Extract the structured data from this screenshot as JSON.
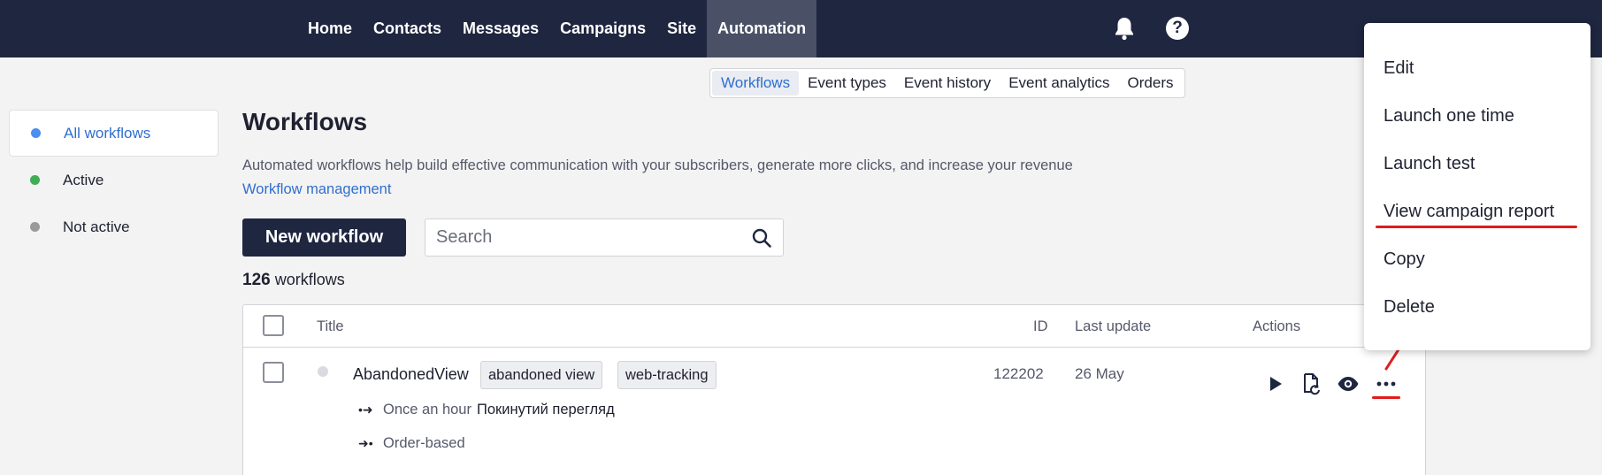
{
  "nav": {
    "items": [
      {
        "label": "Home",
        "active": false
      },
      {
        "label": "Contacts",
        "active": false
      },
      {
        "label": "Messages",
        "active": false
      },
      {
        "label": "Campaigns",
        "active": false
      },
      {
        "label": "Site",
        "active": false
      },
      {
        "label": "Automation",
        "active": true
      }
    ],
    "icons": [
      "bell-icon",
      "help-icon"
    ],
    "help_glyph": "?"
  },
  "subnav": {
    "items": [
      {
        "label": "Workflows",
        "active": true
      },
      {
        "label": "Event types",
        "active": false
      },
      {
        "label": "Event history",
        "active": false
      },
      {
        "label": "Event analytics",
        "active": false
      },
      {
        "label": "Orders",
        "active": false
      }
    ]
  },
  "sidebar": {
    "items": [
      {
        "label": "All workflows",
        "color": "#4a8ef0",
        "active": true
      },
      {
        "label": "Active",
        "color": "#3fae55",
        "active": false
      },
      {
        "label": "Not active",
        "color": "#9a9a9a",
        "active": false
      }
    ]
  },
  "page": {
    "title": "Workflows",
    "description": "Automated workflows help build effective communication with your subscribers, generate more clicks, and increase your revenue",
    "management_link": "Workflow management",
    "new_button": "New workflow",
    "search_placeholder": "Search",
    "count": "126",
    "count_label": " workflows"
  },
  "table": {
    "headers": {
      "title": "Title",
      "id": "ID",
      "last_update": "Last update",
      "actions": "Actions"
    },
    "rows": [
      {
        "name": "AbandonedView",
        "tags": [
          "abandoned view",
          "web-tracking"
        ],
        "triggers": [
          {
            "label": "Once an hour",
            "extra": "Покинутий перегляд"
          },
          {
            "label": "Order-based",
            "extra": ""
          }
        ],
        "id": "122202",
        "last_update": "26 May"
      }
    ]
  },
  "menu": {
    "items": [
      "Edit",
      "Launch one time",
      "Launch test",
      "View campaign report",
      "Copy",
      "Delete"
    ],
    "highlighted": "View campaign report"
  },
  "colors": {
    "topbar": "#1e2640",
    "accent": "#2f6fcf",
    "annotation": "#e21b1b"
  }
}
